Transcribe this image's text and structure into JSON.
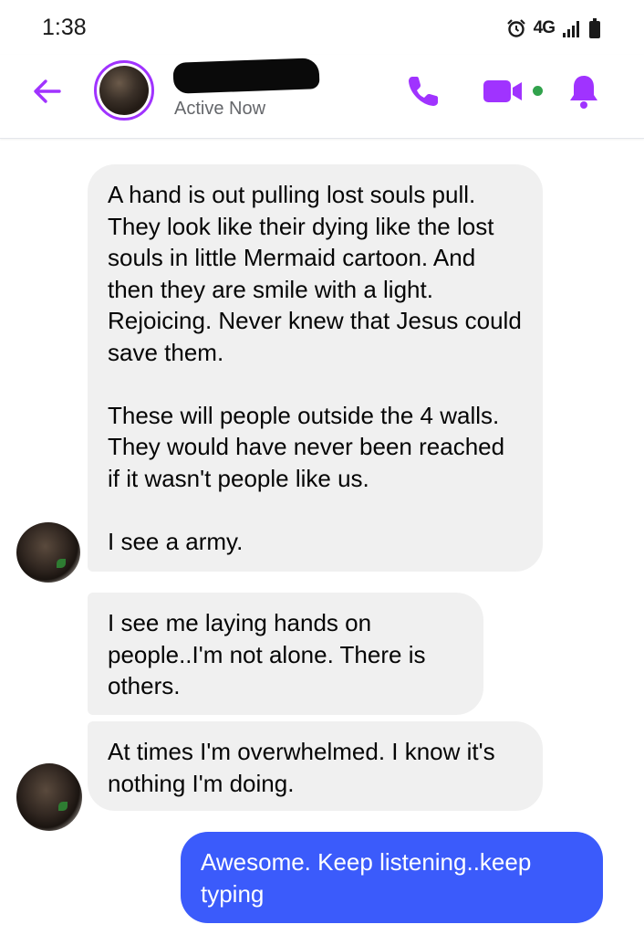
{
  "status_bar": {
    "time": "1:38",
    "network": "4G",
    "icons": [
      "alarm-icon",
      "signal-icon",
      "battery-icon"
    ]
  },
  "header": {
    "status": "Active Now",
    "accent_color": "#a033ff",
    "active_dot_color": "#31a24c",
    "icons": [
      "back-arrow-icon",
      "phone-icon",
      "video-camera-icon",
      "bell-icon"
    ]
  },
  "messages": [
    {
      "direction": "incoming",
      "paragraphs": [
        "A hand is out pulling lost souls pull. They look like their dying like the lost souls in little Mermaid cartoon. And then they are smile with a light. Rejoicing. Never knew that Jesus could save them.",
        "These will people outside the 4 walls. They would have never been reached if it wasn't people like us.",
        "I see a army."
      ]
    },
    {
      "direction": "incoming",
      "paragraphs": [
        "I see me laying hands on people..I'm not alone. There is others."
      ]
    },
    {
      "direction": "incoming",
      "paragraphs": [
        "At times I'm overwhelmed. I know it's nothing I'm doing."
      ]
    },
    {
      "direction": "outgoing",
      "paragraphs": [
        "Awesome.  Keep listening..keep typing"
      ]
    }
  ],
  "colors": {
    "incoming_bubble": "#f0f0f0",
    "outgoing_bubble": "#3b5bfb",
    "outgoing_text": "#ffffff"
  }
}
